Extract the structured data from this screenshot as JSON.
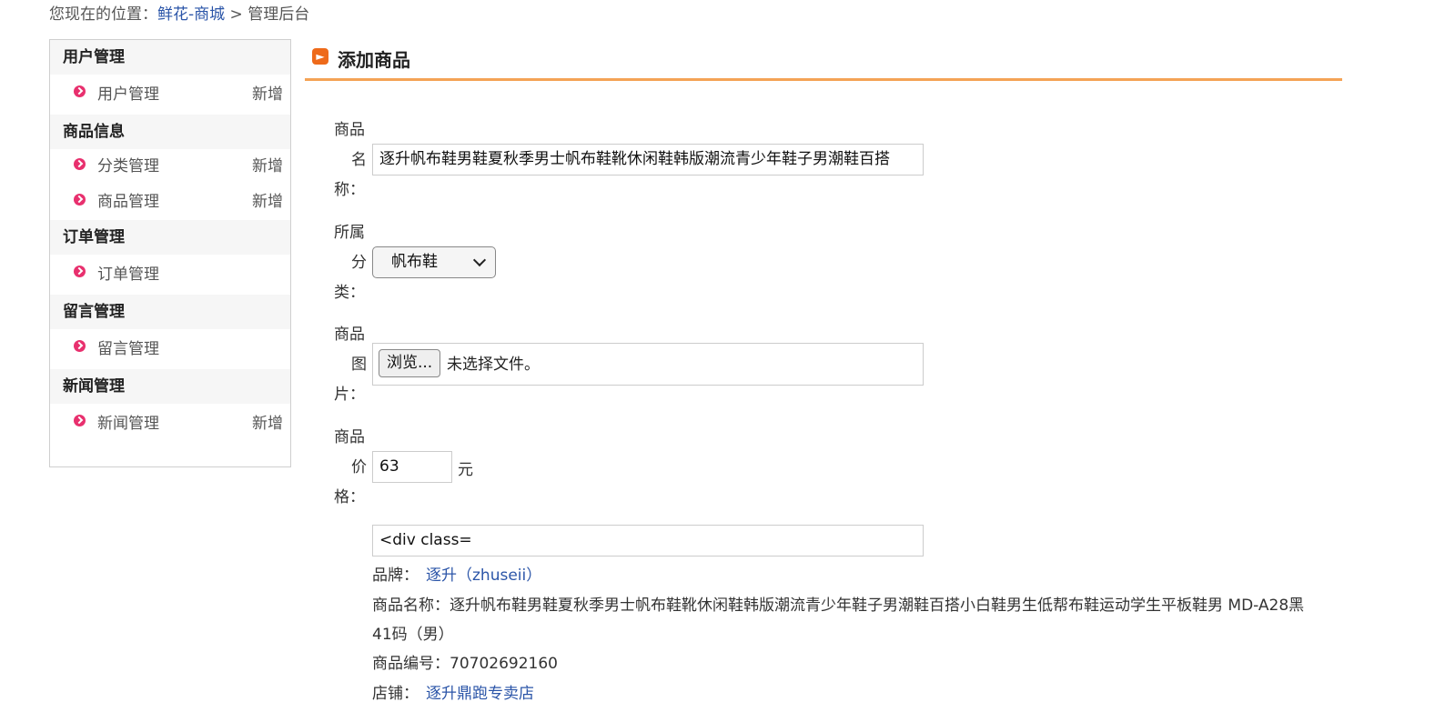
{
  "breadcrumb": {
    "prefix": "您现在的位置：",
    "link": "鲜花-商城",
    "sep": " > ",
    "current": "管理后台"
  },
  "sidebar": {
    "groups": [
      {
        "title": "用户管理",
        "items": [
          {
            "label": "用户管理",
            "add": "新增"
          }
        ]
      },
      {
        "title": "商品信息",
        "items": [
          {
            "label": "分类管理",
            "add": "新增"
          },
          {
            "label": "商品管理",
            "add": "新增"
          }
        ]
      },
      {
        "title": "订单管理",
        "items": [
          {
            "label": "订单管理"
          }
        ]
      },
      {
        "title": "留言管理",
        "items": [
          {
            "label": "留言管理"
          }
        ]
      },
      {
        "title": "新闻管理",
        "items": [
          {
            "label": "新闻管理",
            "add": "新增"
          }
        ]
      }
    ]
  },
  "main": {
    "title": "添加商品",
    "name_label": [
      "商品",
      "名",
      "称："
    ],
    "name_value": "逐升帆布鞋男鞋夏秋季男士帆布鞋靴休闲鞋韩版潮流青少年鞋子男潮鞋百搭",
    "category_label": [
      "所属",
      "分",
      "类："
    ],
    "category_value": "帆布鞋",
    "image_label": [
      "商品",
      "图",
      "片："
    ],
    "browse_label": "浏览...",
    "no_file": "未选择文件。",
    "price_label": [
      "商品",
      "价",
      "格："
    ],
    "price_value": "63",
    "price_unit": "元",
    "desc_value": "<div class=",
    "details": {
      "brand_label": "品牌：",
      "brand_value": "逐升（zhuseii）",
      "name_label": "商品名称：",
      "name_value": "逐升帆布鞋男鞋夏秋季男士帆布鞋靴休闲鞋韩版潮流青少年鞋子男潮鞋百搭小白鞋男生低帮布鞋运动学生平板鞋男 MD-A28黑",
      "size_value": "41码（男）",
      "sku_label": "商品编号：",
      "sku_value": "70702692160",
      "shop_label": "店铺：",
      "shop_value": "逐升鼎跑专卖店"
    }
  }
}
